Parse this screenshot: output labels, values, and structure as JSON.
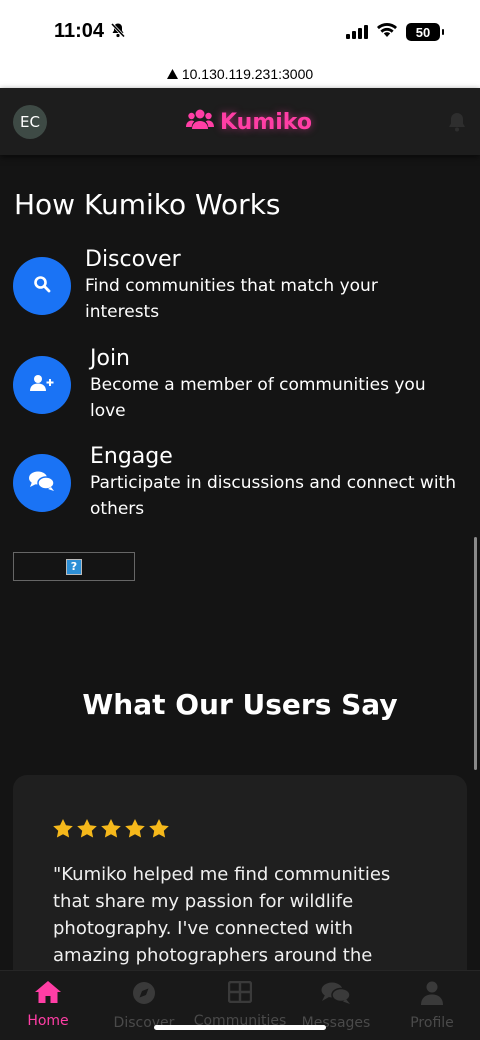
{
  "status_bar": {
    "time": "11:04",
    "battery": "50"
  },
  "browser": {
    "url": "10.130.119.231:3000"
  },
  "header": {
    "avatar_initials": "EC",
    "brand": "Kumiko"
  },
  "how_it_works": {
    "title": "How Kumiko Works",
    "steps": [
      {
        "title": "Discover",
        "desc": "Find communities that match your interests",
        "icon": "search-icon"
      },
      {
        "title": "Join",
        "desc": "Become a member of communities you love",
        "icon": "user-plus-icon"
      },
      {
        "title": "Engage",
        "desc": "Participate in discussions and connect with others",
        "icon": "chat-bubbles-icon"
      }
    ]
  },
  "testimonials": {
    "title": "What Our Users Say",
    "rating": 5,
    "quote": "\"Kumiko helped me find communities that share my passion for wildlife photography. I've connected with amazing photographers around the"
  },
  "bottom_nav": [
    {
      "label": "Home",
      "icon": "home-icon",
      "active": true
    },
    {
      "label": "Discover",
      "icon": "compass-icon",
      "active": false
    },
    {
      "label": "Communities",
      "icon": "grid-icon",
      "active": false
    },
    {
      "label": "Messages",
      "icon": "chat-icon",
      "active": false
    },
    {
      "label": "Profile",
      "icon": "user-icon",
      "active": false
    }
  ],
  "colors": {
    "accent": "#ff3ea5",
    "step_icon_bg": "#1a73f5",
    "star": "#f5b81b",
    "background": "#141414"
  }
}
